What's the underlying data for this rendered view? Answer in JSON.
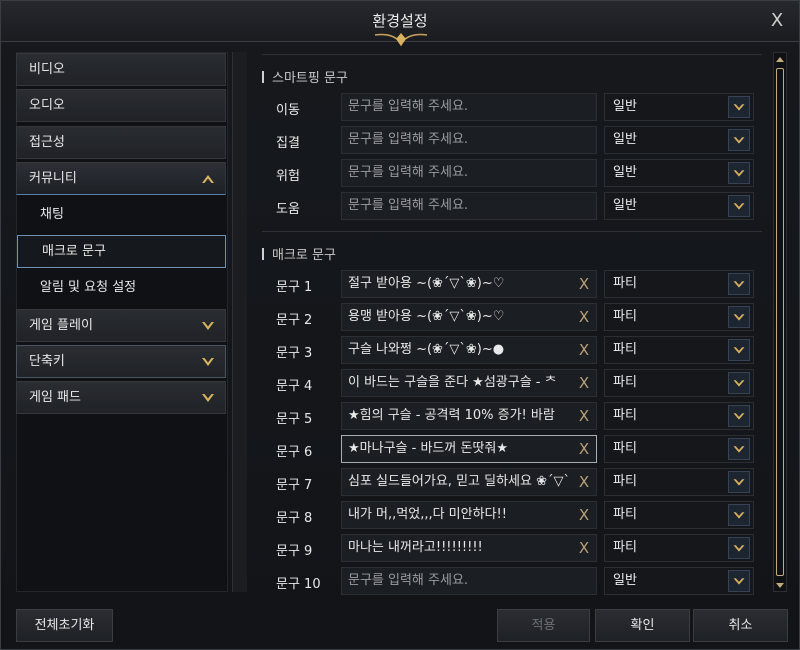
{
  "window": {
    "title": "환경설정",
    "close_label": "X"
  },
  "sidebar": {
    "items": [
      {
        "label": "비디오"
      },
      {
        "label": "오디오"
      },
      {
        "label": "접근성"
      },
      {
        "label": "커뮤니티"
      },
      {
        "label": "채팅"
      },
      {
        "label": "매크로 문구"
      },
      {
        "label": "알림 및 요청 설정"
      },
      {
        "label": "게임 플레이"
      },
      {
        "label": "단축키"
      },
      {
        "label": "게임 패드"
      }
    ]
  },
  "smart_ping": {
    "title": "스마트핑 문구",
    "rows": [
      {
        "label": "이동",
        "value": "",
        "placeholder": "문구를 입력해 주세요.",
        "option": "일반"
      },
      {
        "label": "집결",
        "value": "",
        "placeholder": "문구를 입력해 주세요.",
        "option": "일반"
      },
      {
        "label": "위험",
        "value": "",
        "placeholder": "문구를 입력해 주세요.",
        "option": "일반"
      },
      {
        "label": "도움",
        "value": "",
        "placeholder": "문구를 입력해 주세요.",
        "option": "일반"
      }
    ]
  },
  "macro": {
    "title": "매크로 문구",
    "clear_label": "X",
    "rows": [
      {
        "label": "문구 1",
        "value": "절구 받아용 ~(❀ˊ▽ˋ❀)~♡",
        "option": "파티"
      },
      {
        "label": "문구 2",
        "value": "용맹 받아용 ~(❀ˊ▽ˋ❀)~♡",
        "option": "파티"
      },
      {
        "label": "문구 3",
        "value": "구슬 나와쩡 ~(❀ˊ▽ˋ❀)~●",
        "option": "파티"
      },
      {
        "label": "문구 4",
        "value": "이 바드는 구슬을 준다    ★섬광구슬 - ᄎ",
        "option": "파티"
      },
      {
        "label": "문구 5",
        "value": "★힘의 구슬 - 공격력 10% 증가!    바람",
        "option": "파티"
      },
      {
        "label": "문구 6",
        "value": "★마나구슬 - 바드꺼 돈땃줘★",
        "option": "파티"
      },
      {
        "label": "문구 7",
        "value": "심포 실드들어가요, 믿고 딜하세요 ❀ˊ▽ˋ",
        "option": "파티"
      },
      {
        "label": "문구 8",
        "value": "내가 머,,먹었,,,다 미안하다!!",
        "option": "파티"
      },
      {
        "label": "문구 9",
        "value": "마나는 내꺼라고!!!!!!!!!",
        "option": "파티"
      },
      {
        "label": "문구 10",
        "value": "",
        "placeholder": "문구를 입력해 주세요.",
        "option": "일반"
      }
    ]
  },
  "footer": {
    "reset_all": "전체초기화",
    "apply": "적용",
    "confirm": "확인",
    "cancel": "취소"
  },
  "colors": {
    "accent_gold": "#d9b25f",
    "selected_border": "#6f8fb3",
    "chevron_blue": "#364357"
  },
  "icons": [
    "chevron-up-icon",
    "chevron-down-icon",
    "clear-icon",
    "ornament-icon",
    "scroll-arrow-icon"
  ]
}
